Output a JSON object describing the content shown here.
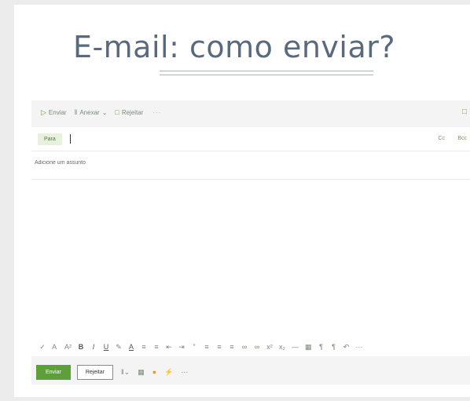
{
  "slide": {
    "title": "E-mail: como enviar?"
  },
  "toolbar": {
    "send": {
      "label": "Enviar",
      "icon": "send-icon"
    },
    "attach": {
      "label": "Anexar",
      "icon": "paperclip-icon"
    },
    "discard": {
      "label": "Rejeitar",
      "icon": "trash-icon"
    },
    "more": "···",
    "popout_icon": "popout-icon"
  },
  "compose": {
    "to_label": "Para",
    "cc_label": "Cc",
    "bcc_label": "Bcc",
    "subject_placeholder": "Adicione um assunto"
  },
  "format_bar": {
    "icons": [
      "format-painter-icon",
      "font-size-icon",
      "superscript-size-icon",
      "bold-icon",
      "italic-icon",
      "underline-icon",
      "highlight-icon",
      "font-color-icon",
      "bullets-icon",
      "numbering-icon",
      "decrease-indent-icon",
      "increase-indent-icon",
      "quote-icon",
      "align-left-icon",
      "align-center-icon",
      "align-right-icon",
      "link-icon",
      "unlink-icon",
      "superscript-icon",
      "subscript-icon",
      "strikethrough-icon",
      "table-icon",
      "ltr-icon",
      "rtl-icon",
      "undo-icon",
      "more-icon"
    ],
    "bold": "B",
    "italic": "I",
    "underline": "U",
    "more": "···"
  },
  "actions": {
    "send_label": "Enviar",
    "discard_label": "Rejeitar",
    "more": "···"
  },
  "colors": {
    "accent": "#5da03a",
    "title": "#5a6a7e"
  }
}
